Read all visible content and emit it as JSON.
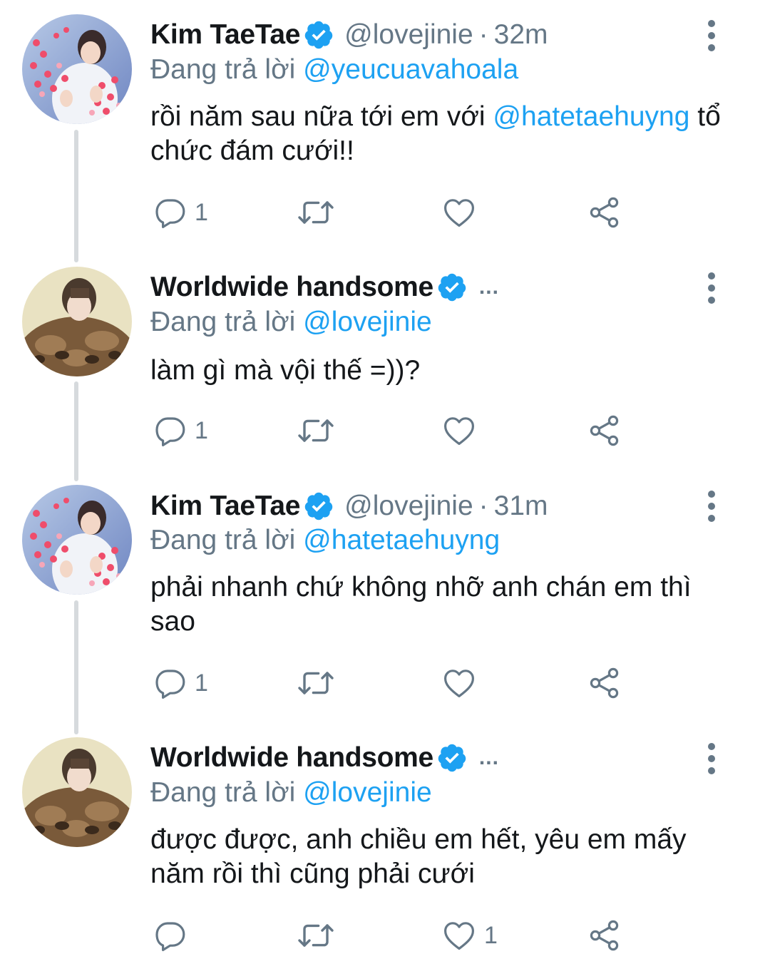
{
  "icons": {
    "reply": "reply-icon",
    "retweet": "retweet-icon",
    "like": "heart-icon",
    "share": "share-icon",
    "more": "more-vertical-icon",
    "verified": "verified-badge-icon"
  },
  "colors": {
    "link": "#1da1f2",
    "muted": "#657786",
    "text": "#14171a",
    "verified": "#1da1f2"
  },
  "tweets": [
    {
      "name": "Kim TaeTae",
      "handle": "@lovejinie",
      "separator": "·",
      "time": "32m",
      "reply_prefix": "Đang trả lời ",
      "reply_to": "@yeucuavahoala",
      "text_before": "rồi năm sau nữa tới em với ",
      "text_mention": "@hatetaehuyng",
      "text_after": " tổ chức đám cưới!!",
      "reply_count": "1",
      "like_count": ""
    },
    {
      "name": "Worldwide handsome",
      "handle_truncated": "...",
      "reply_prefix": "Đang trả lời ",
      "reply_to": "@lovejinie",
      "text": "làm gì mà vội thế =))?",
      "reply_count": "1",
      "like_count": ""
    },
    {
      "name": "Kim TaeTae",
      "handle": "@lovejinie",
      "separator": "·",
      "time": "31m",
      "reply_prefix": "Đang trả lời ",
      "reply_to": "@hatetaehuyng",
      "text": "phải nhanh chứ không nhỡ anh chán em thì sao",
      "reply_count": "1",
      "like_count": ""
    },
    {
      "name": "Worldwide handsome",
      "handle_truncated": "...",
      "reply_prefix": "Đang trả lời ",
      "reply_to": "@lovejinie",
      "text": "được được, anh chiều em hết, yêu em mấy năm rồi thì cũng phải cưới",
      "reply_count": "",
      "like_count": "1"
    }
  ]
}
